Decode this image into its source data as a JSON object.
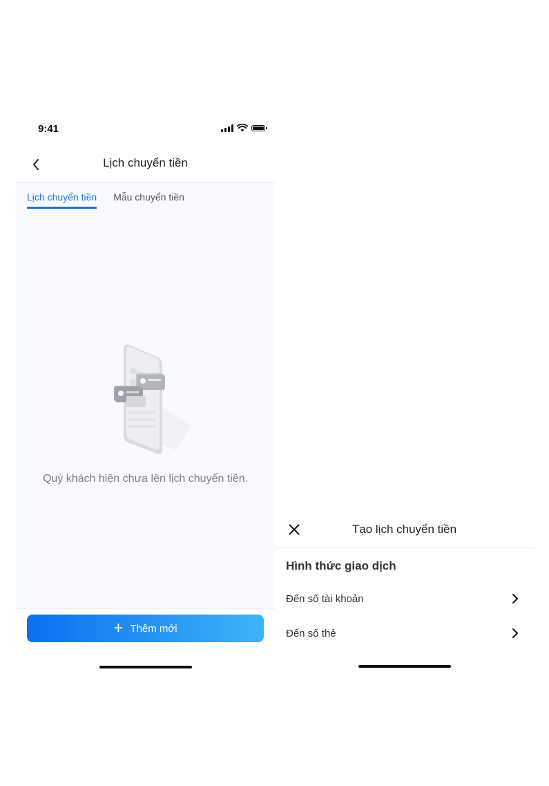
{
  "left_screen": {
    "status_bar": {
      "time": "9:41"
    },
    "nav": {
      "title": "Lịch chuyển tiền"
    },
    "tabs": [
      {
        "label": "Lịch chuyển tiền",
        "active": true
      },
      {
        "label": "Mẫu chuyển tiền",
        "active": false
      }
    ],
    "empty_state": {
      "message": "Quý khách hiện chưa lên lịch chuyển tiền."
    },
    "add_button": {
      "label": "Thêm mới"
    }
  },
  "right_sheet": {
    "title": "Tạo lịch chuyển tiền",
    "section_title": "Hình thức giao dịch",
    "options": [
      {
        "label": "Đến số tài khoản"
      },
      {
        "label": "Đến số thẻ"
      }
    ]
  },
  "colors": {
    "accent": "#1e73d9",
    "button_gradient_start": "#0a6fef",
    "button_gradient_end": "#3fb4f6",
    "content_background": "#f8fafd",
    "muted_text": "#7b7f86"
  },
  "icons": [
    "back-arrow-icon",
    "signal-icon",
    "wifi-icon",
    "battery-icon",
    "plus-icon",
    "close-icon",
    "chevron-right-icon"
  ]
}
